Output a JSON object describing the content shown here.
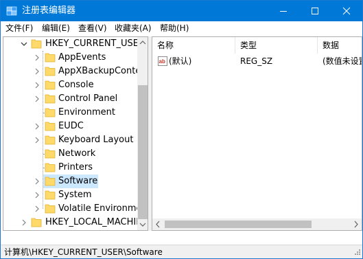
{
  "window": {
    "title": "注册表编辑器",
    "accent": "#0078d7"
  },
  "menu": {
    "items": [
      {
        "label": "文件(F)"
      },
      {
        "label": "编辑(E)"
      },
      {
        "label": "查看(V)"
      },
      {
        "label": "收藏夹(A)"
      },
      {
        "label": "帮助(H)"
      }
    ]
  },
  "tree": {
    "root": {
      "label": "HKEY_CURRENT_USER",
      "expanded": true
    },
    "children": [
      {
        "label": "AppEvents",
        "expandable": true
      },
      {
        "label": "AppXBackupContentType",
        "expandable": true
      },
      {
        "label": "Console",
        "expandable": true
      },
      {
        "label": "Control Panel",
        "expandable": true
      },
      {
        "label": "Environment",
        "expandable": false
      },
      {
        "label": "EUDC",
        "expandable": true
      },
      {
        "label": "Keyboard Layout",
        "expandable": true
      },
      {
        "label": "Network",
        "expandable": false
      },
      {
        "label": "Printers",
        "expandable": false
      },
      {
        "label": "Software",
        "expandable": true,
        "selected": true
      },
      {
        "label": "System",
        "expandable": true
      },
      {
        "label": "Volatile Environment",
        "expandable": true
      }
    ],
    "sibling": {
      "label": "HKEY_LOCAL_MACHINE",
      "expanded": false
    },
    "selection_color": "#cce8ff"
  },
  "list": {
    "columns": [
      {
        "label": "名称"
      },
      {
        "label": "类型"
      },
      {
        "label": "数据"
      }
    ],
    "rows": [
      {
        "icon": "string-value-icon",
        "name": "(默认)",
        "type": "REG_SZ",
        "data": "(数值未设置)"
      }
    ]
  },
  "status": {
    "path": "计算机\\HKEY_CURRENT_USER\\Software"
  }
}
